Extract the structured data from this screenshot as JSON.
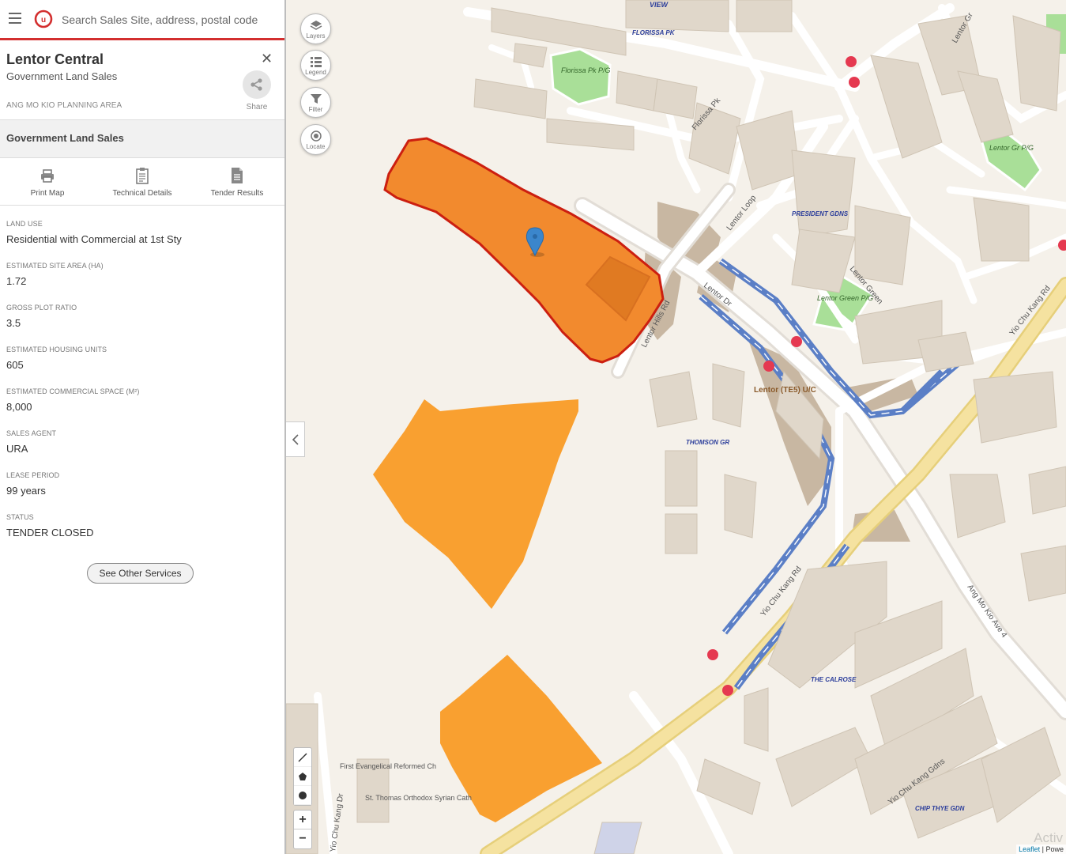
{
  "search": {
    "placeholder": "Search Sales Site, address, postal code"
  },
  "site": {
    "title": "Lentor Central",
    "subtitle": "Government Land Sales",
    "planning_area": "ANG MO KIO PLANNING AREA",
    "share_label": "Share"
  },
  "section": {
    "title": "Government Land Sales"
  },
  "actions": [
    {
      "label": "Print Map",
      "icon": "printer-icon"
    },
    {
      "label": "Technical Details",
      "icon": "clipboard-icon"
    },
    {
      "label": "Tender Results",
      "icon": "document-icon"
    }
  ],
  "fields": [
    {
      "label": "LAND USE",
      "value": "Residential with Commercial at 1st Sty"
    },
    {
      "label": "ESTIMATED SITE AREA (HA)",
      "value": "1.72"
    },
    {
      "label": "GROSS PLOT RATIO",
      "value": "3.5"
    },
    {
      "label": "ESTIMATED HOUSING UNITS",
      "value": "605"
    },
    {
      "label": "ESTIMATED COMMERCIAL SPACE (M²)",
      "value": "8,000"
    },
    {
      "label": "SALES AGENT",
      "value": "URA"
    },
    {
      "label": "LEASE PERIOD",
      "value": "99 years"
    },
    {
      "label": "STATUS",
      "value": "TENDER CLOSED"
    }
  ],
  "other_services_label": "See Other Services",
  "map_controls": {
    "layers": "Layers",
    "legend": "Legend",
    "filter": "Filter",
    "locate": "Locate",
    "zoom_in": "+",
    "zoom_out": "−"
  },
  "map_labels": {
    "roads": [
      "Lentor Loop",
      "Lentor Dr",
      "Lentor Hills Rd",
      "Lentor Green",
      "Yio Chu Kang Rd",
      "Ang Mo Kio Ave 4",
      "Florissa Pk",
      "Lentor Gr",
      "Yio Chu Kang Dr",
      "Yio Chu Kang Gdns",
      "VIEW"
    ],
    "places": [
      "FLORISSA PK",
      "PRESIDENT GDNS",
      "THOMSON GR",
      "THE CALROSE",
      "CHIP THYE GDN",
      "Lentor (TE5) U/C",
      "First Evangelical Reformed Ch",
      "St. Thomas Orthodox Syrian Cath"
    ],
    "parks": [
      "Florissa Pk P/G",
      "Lentor Green P/G",
      "Lentor Gr P/G"
    ]
  },
  "attribution": {
    "leaflet": "Leaflet",
    "rest": "| Powe"
  },
  "watermark": "Activ",
  "colors": {
    "accent": "#d32f2f",
    "selected_site": "#f28a2e",
    "other_site": "#f9a030",
    "selected_outline": "#cc1f10",
    "mrt_line": "#5b7fc6",
    "main_road": "#f3dc8c"
  }
}
